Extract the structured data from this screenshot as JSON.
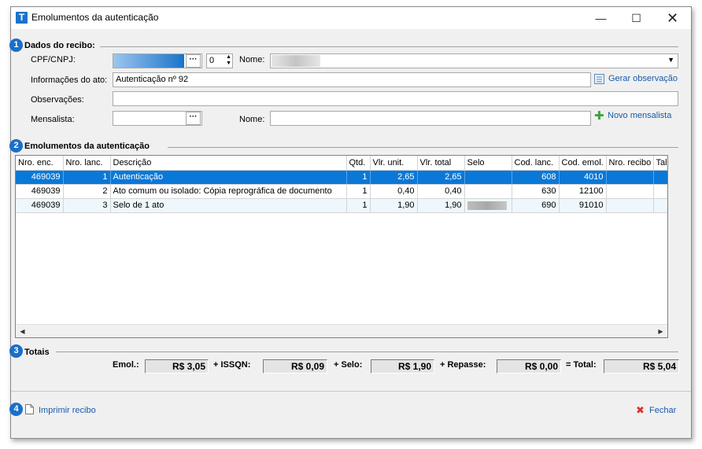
{
  "window": {
    "title": "Emolumentos da autenticação",
    "app_icon": "T",
    "controls": {
      "minimize": "—",
      "maximize": "☐",
      "close": "✕"
    }
  },
  "section1": {
    "number": "1",
    "title": "Dados do recibo:",
    "cpf_label": "CPF/CNPJ:",
    "cpf_number": "0",
    "nome_label": "Nome:",
    "info_label": "Informações do ato:",
    "info_value": "Autenticação nº 92",
    "gerar_observacao": "Gerar observação",
    "obs_label": "Observações:",
    "obs_value": "",
    "mensalista_label": "Mensalista:",
    "mensalista_value": "",
    "nome2_label": "Nome:",
    "nome2_value": "",
    "novo_mensalista": "Novo mensalista",
    "ellipsis": "···"
  },
  "section2": {
    "number": "2",
    "title": "Emolumentos da autenticação",
    "columns": [
      "Nro. enc.",
      "Nro. lanc.",
      "Descrição",
      "Qtd.",
      "Vlr. unit.",
      "Vlr. total",
      "Selo",
      "Cod. lanc.",
      "Cod. emol.",
      "Nro. recibo",
      "Tal"
    ],
    "rows": [
      {
        "nro_enc": "469039",
        "nro_lanc": "1",
        "descricao": "Autenticação",
        "qtd": "1",
        "vlr_unit": "2,65",
        "vlr_total": "2,65",
        "selo": "",
        "cod_lanc": "608",
        "cod_emol": "4010",
        "nro_recibo": "",
        "tal": ""
      },
      {
        "nro_enc": "469039",
        "nro_lanc": "2",
        "descricao": "Ato comum ou isolado: Cópia reprográfica de documento",
        "qtd": "1",
        "vlr_unit": "0,40",
        "vlr_total": "0,40",
        "selo": "",
        "cod_lanc": "630",
        "cod_emol": "12100",
        "nro_recibo": "",
        "tal": ""
      },
      {
        "nro_enc": "469039",
        "nro_lanc": "3",
        "descricao": "Selo de 1 ato",
        "qtd": "1",
        "vlr_unit": "1,90",
        "vlr_total": "1,90",
        "selo": "",
        "cod_lanc": "690",
        "cod_emol": "91010",
        "nro_recibo": "",
        "tal": ""
      }
    ],
    "scroll_left": "◀",
    "scroll_right": "▶"
  },
  "section3": {
    "number": "3",
    "title": "Totais",
    "emol_label": "Emol.:",
    "emol_value": "R$ 3,05",
    "issqn_label": "+ ISSQN:",
    "issqn_value": "R$ 0,09",
    "selo_label": "+ Selo:",
    "selo_value": "R$ 1,90",
    "repasse_label": "+ Repasse:",
    "repasse_value": "R$ 0,00",
    "total_label": "= Total:",
    "total_value": "R$ 5,04"
  },
  "footer": {
    "number": "4",
    "imprimir": "Imprimir recibo",
    "fechar": "Fechar"
  },
  "icons": {
    "gerar_observacao": "list-document-icon",
    "novo_mensalista": "green-plus-icon",
    "imprimir": "document-icon",
    "fechar": "red-x-icon"
  },
  "colors": {
    "selection": "#0a78d7",
    "badge": "#1a6fc9",
    "link": "#1a5aa8",
    "masked_value": "#1a73c9"
  }
}
